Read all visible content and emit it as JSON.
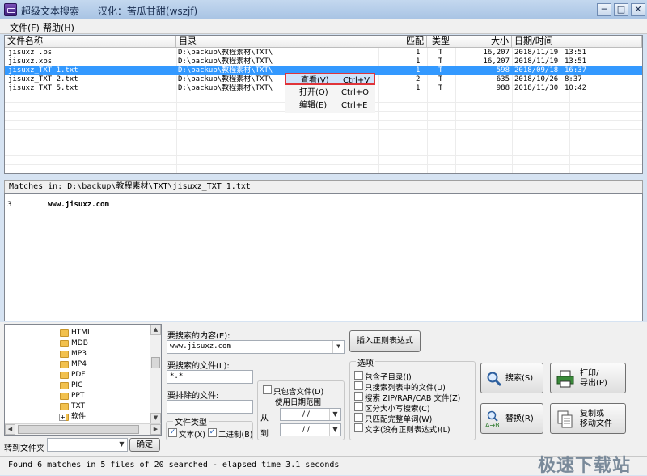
{
  "window": {
    "title": "超级文本搜索",
    "subtitle": "汉化：苦瓜甘甜(wszjf)",
    "minimize": "─",
    "maximize": "□",
    "close": "✕"
  },
  "menu": [
    "文件(F)",
    "帮助(H)"
  ],
  "filelist": {
    "columns": [
      "文件名称",
      "目录",
      "匹配",
      "类型",
      "大小",
      "日期/时间"
    ],
    "rows": [
      {
        "name": "jisuxz .ps",
        "dir": "D:\\backup\\教程素材\\TXT\\",
        "matches": "1",
        "type": "T",
        "size": "16,207",
        "date": "2018/11/19",
        "time": "13:51",
        "selected": false
      },
      {
        "name": "jisuxz.xps",
        "dir": "D:\\backup\\教程素材\\TXT\\",
        "matches": "1",
        "type": "T",
        "size": "16,207",
        "date": "2018/11/19",
        "time": "13:51",
        "selected": false
      },
      {
        "name": "jisuxz_TXT 1.txt",
        "dir": "D:\\backup\\教程素材\\TXT\\",
        "matches": "1",
        "type": "T",
        "size": "598",
        "date": "2018/09/18",
        "time": "16:37",
        "selected": true
      },
      {
        "name": "jisuxz_TXT 2.txt",
        "dir": "D:\\backup\\教程素材\\TXT\\",
        "matches": "2",
        "type": "T",
        "size": "635",
        "date": "2018/10/26",
        "time": "8:37",
        "selected": false
      },
      {
        "name": "jisuxz_TXT 5.txt",
        "dir": "D:\\backup\\教程素材\\TXT\\",
        "matches": "1",
        "type": "T",
        "size": "988",
        "date": "2018/11/30",
        "time": "10:42",
        "selected": false
      }
    ]
  },
  "context_menu": [
    {
      "label": "查看(V)",
      "shortcut": "Ctrl+V"
    },
    {
      "label": "打开(O)",
      "shortcut": "Ctrl+O"
    },
    {
      "label": "编辑(E)",
      "shortcut": "Ctrl+E"
    }
  ],
  "matches": {
    "header": "Matches in: D:\\backup\\教程素材\\TXT\\jisuxz_TXT 1.txt",
    "line_number": "3",
    "line_text": "www.jisuxz.com"
  },
  "tree": [
    "HTML",
    "MDB",
    "MP3",
    "MP4",
    "PDF",
    "PIC",
    "PPT",
    "TXT",
    "软件"
  ],
  "goto": {
    "label": "转到文件夹",
    "ok": "确定"
  },
  "search": {
    "content_label": "要搜索的内容(E):",
    "content_value": "www.jisuxz.com",
    "regex_button": "插入正则表达式",
    "files_label": "要搜索的文件(L):",
    "files_value": "*.*",
    "exclude_label": "要排除的文件:",
    "exclude_value": "",
    "filetype_title": "文件类型",
    "text_label": "文本(X)",
    "binary_label": "二进制(B)",
    "daterange_check": "只包含文件(D)",
    "daterange_label": "使用日期范围",
    "from_label": "从",
    "to_label": "到",
    "date_placeholder": "/  /"
  },
  "options": {
    "title": "选项",
    "items": [
      {
        "label": "包含子目录(I)",
        "checked": false
      },
      {
        "label": "只搜索列表中的文件(U)",
        "checked": false
      },
      {
        "label": "搜索 ZIP/RAR/CAB 文件(Z)",
        "checked": false
      },
      {
        "label": "区分大小写搜索(C)",
        "checked": false
      },
      {
        "label": "只匹配完整单词(W)",
        "checked": false
      },
      {
        "label": "文字(没有正则表达式)(L)",
        "checked": false
      }
    ]
  },
  "actions": {
    "search": "搜索(S)",
    "replace": "替换(R)",
    "print1": "打印/",
    "print2": "导出(P)",
    "copy1": "复制或",
    "copy2": "移动文件"
  },
  "status": "Found 6 matches in 5 files of 20 searched - elapsed time 3.1 seconds",
  "watermark": "极速下载站"
}
